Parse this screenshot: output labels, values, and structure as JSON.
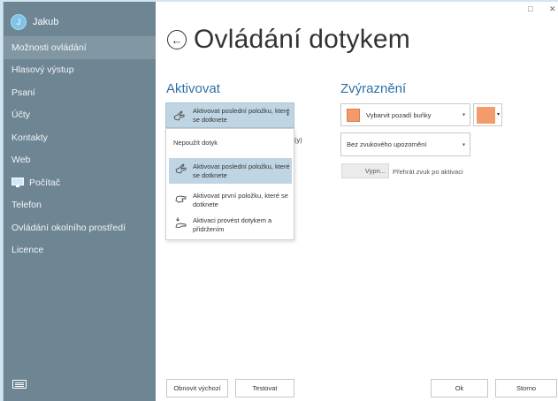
{
  "window": {
    "minimize_glyph": "□",
    "close_glyph": "✕"
  },
  "sidebar": {
    "user": {
      "initial": "J",
      "name": "Jakub"
    },
    "items": [
      {
        "label": "Možnosti ovládání",
        "active": true
      },
      {
        "label": "Hlasový výstup"
      },
      {
        "label": "Psaní"
      },
      {
        "label": "Účty"
      },
      {
        "label": "Kontakty"
      },
      {
        "label": "Web"
      },
      {
        "label": "Počítač",
        "icon": "computer-icon"
      },
      {
        "label": "Telefon"
      },
      {
        "label": "Ovládání okolního prostředí"
      },
      {
        "label": "Licence"
      }
    ],
    "keyboard_icon": "keyboard-icon"
  },
  "header": {
    "back_icon": "←",
    "title": "Ovládání dotykem"
  },
  "activate": {
    "section_title": "Aktivovat",
    "selected": "Aktivovat poslední položku, které se dotknete",
    "hidden_suffix": "(y)",
    "options": {
      "none": "Nepoužít dotyk",
      "last": "Aktivovat poslední položku, které se dotknete",
      "first": "Aktivovat první položku, které se dotknete",
      "hold": "Aktivaci provést dotykem a přidržením"
    }
  },
  "highlight": {
    "section_title": "Zvýraznění",
    "color_mode": "Vybarvit pozadí buňky",
    "color": "#f39b6b",
    "sound": "Bez zvukového upozornění",
    "toggle_state": "Vypn...",
    "toggle_desc": "Přehrát zvuk po aktivaci"
  },
  "footer": {
    "defaults": "Obnovit výchozí",
    "test": "Testovat",
    "ok": "Ok",
    "cancel": "Storno"
  }
}
